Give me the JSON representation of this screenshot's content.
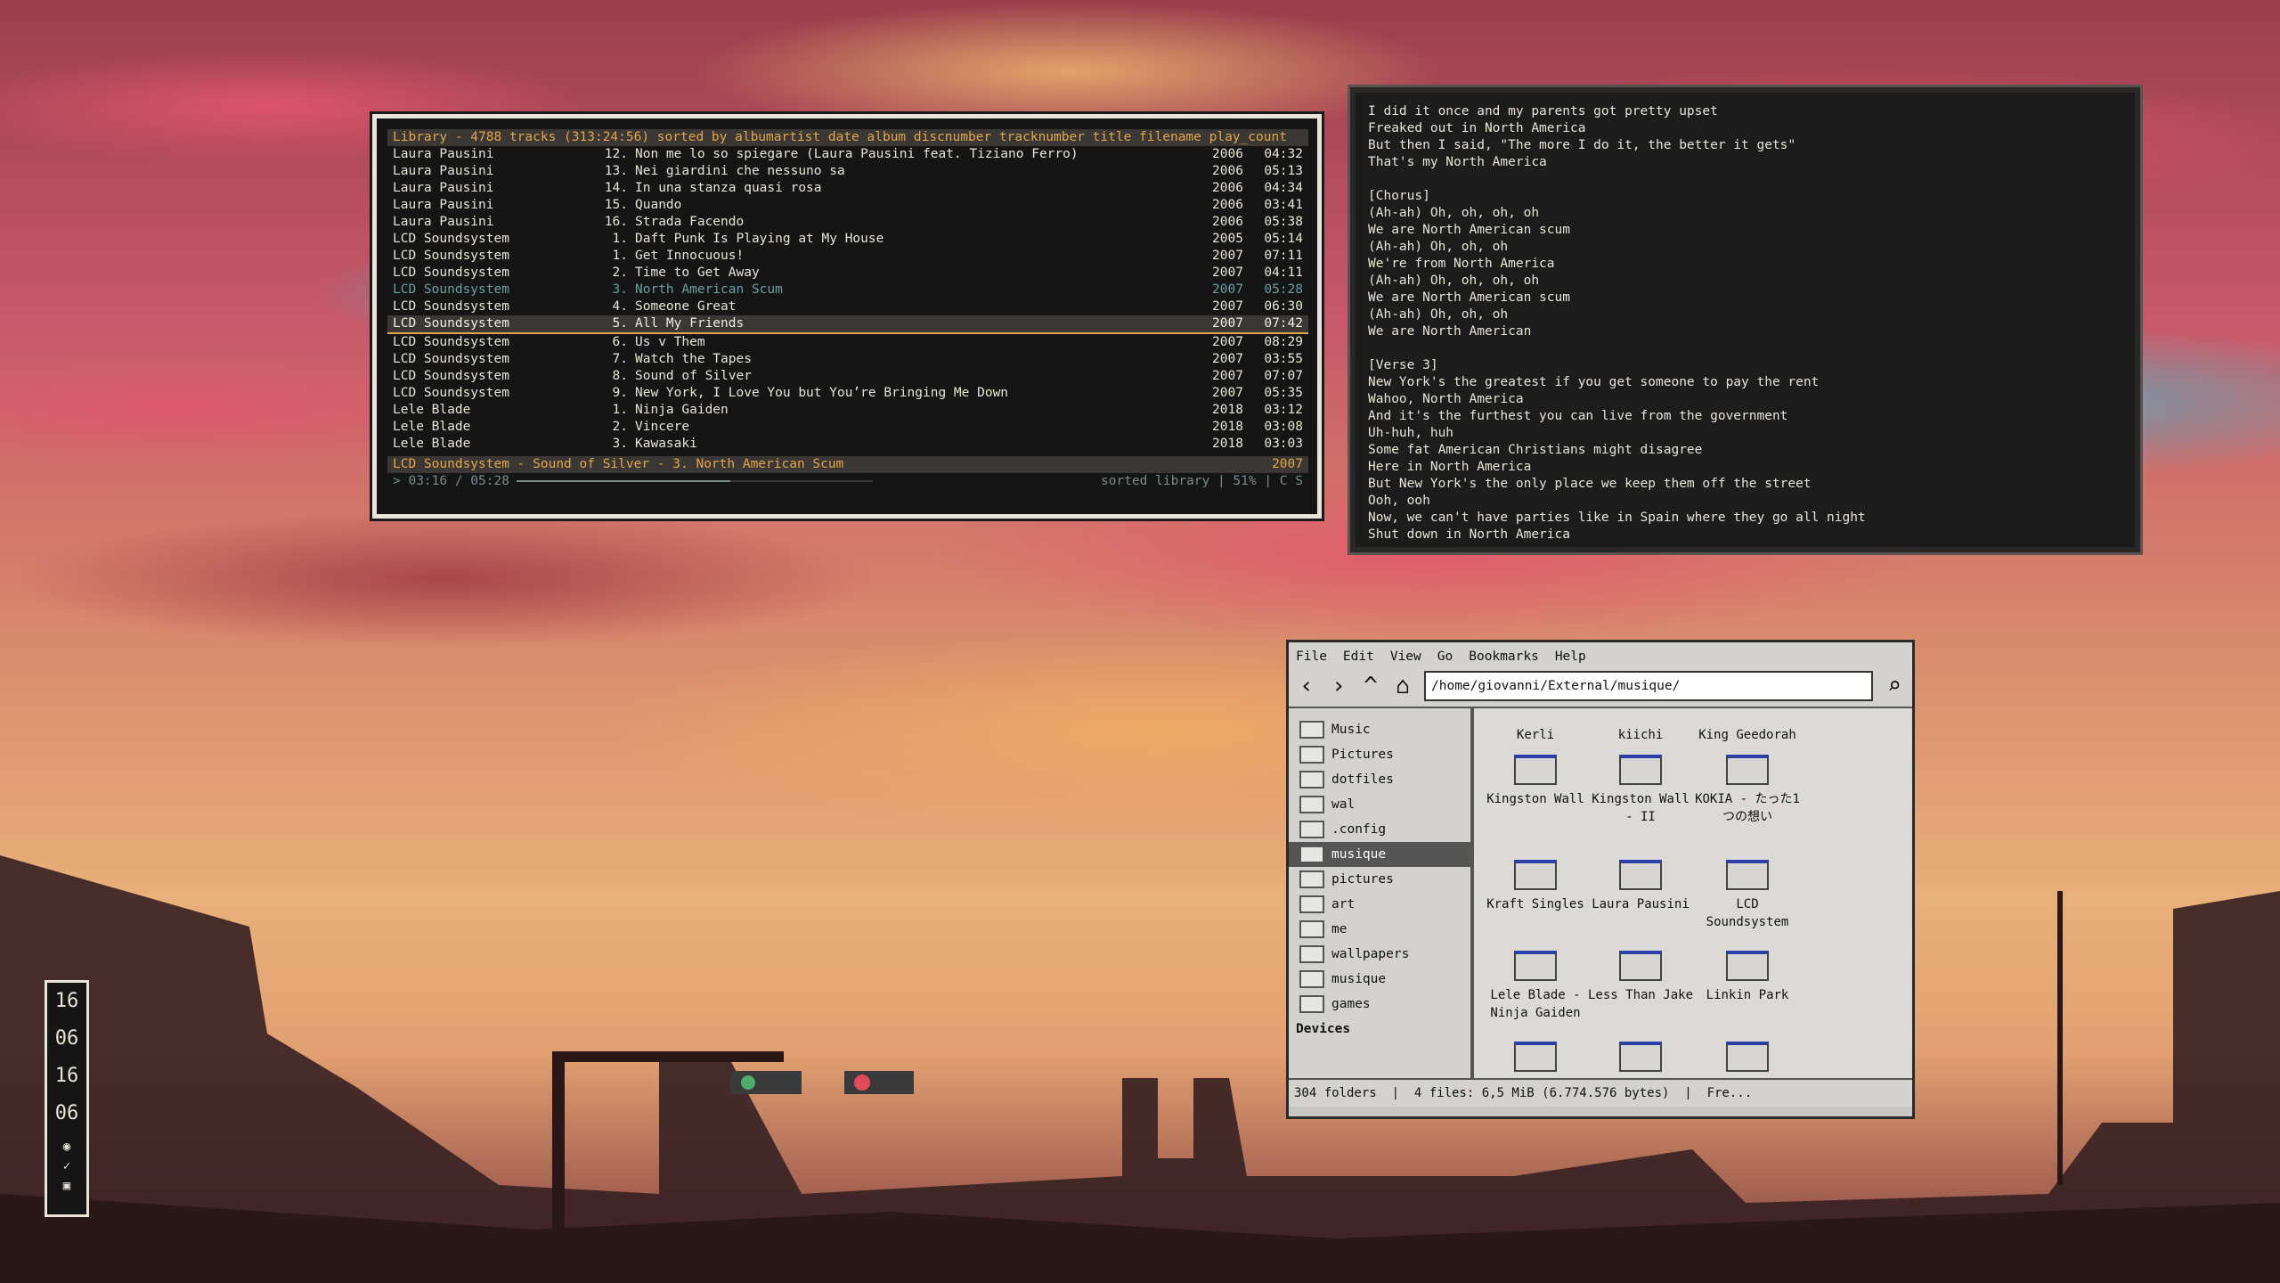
{
  "music_player": {
    "title_line": "Library - 4788 tracks (313:24:56) sorted by albumartist date album discnumber tracknumber title filename play_count",
    "tracks": [
      {
        "artist": "Laura Pausini",
        "num": "12.",
        "title": "Non me lo so spiegare (Laura Pausini feat. Tiziano Ferro)",
        "year": "2006",
        "dur": "04:32"
      },
      {
        "artist": "Laura Pausini",
        "num": "13.",
        "title": "Nei giardini che nessuno sa",
        "year": "2006",
        "dur": "05:13"
      },
      {
        "artist": "Laura Pausini",
        "num": "14.",
        "title": "In una stanza quasi rosa",
        "year": "2006",
        "dur": "04:34"
      },
      {
        "artist": "Laura Pausini",
        "num": "15.",
        "title": "Quando",
        "year": "2006",
        "dur": "03:41"
      },
      {
        "artist": "Laura Pausini",
        "num": "16.",
        "title": "Strada Facendo",
        "year": "2006",
        "dur": "05:38"
      },
      {
        "artist": "LCD Soundsystem",
        "num": "1.",
        "title": "Daft Punk Is Playing at My House",
        "year": "2005",
        "dur": "05:14"
      },
      {
        "artist": "LCD Soundsystem",
        "num": "1.",
        "title": "Get Innocuous!",
        "year": "2007",
        "dur": "07:11"
      },
      {
        "artist": "LCD Soundsystem",
        "num": "2.",
        "title": "Time to Get Away",
        "year": "2007",
        "dur": "04:11"
      },
      {
        "artist": "LCD Soundsystem",
        "num": "3.",
        "title": "North American Scum",
        "year": "2007",
        "dur": "05:28"
      },
      {
        "artist": "LCD Soundsystem",
        "num": "4.",
        "title": "Someone Great",
        "year": "2007",
        "dur": "06:30"
      },
      {
        "artist": "LCD Soundsystem",
        "num": "5.",
        "title": "All My Friends",
        "year": "2007",
        "dur": "07:42"
      },
      {
        "artist": "LCD Soundsystem",
        "num": "6.",
        "title": "Us v Them",
        "year": "2007",
        "dur": "08:29"
      },
      {
        "artist": "LCD Soundsystem",
        "num": "7.",
        "title": "Watch the Tapes",
        "year": "2007",
        "dur": "03:55"
      },
      {
        "artist": "LCD Soundsystem",
        "num": "8.",
        "title": "Sound of Silver",
        "year": "2007",
        "dur": "07:07"
      },
      {
        "artist": "LCD Soundsystem",
        "num": "9.",
        "title": "New York, I Love You but You’re Bringing Me Down",
        "year": "2007",
        "dur": "05:35"
      },
      {
        "artist": "Lele Blade",
        "num": "1.",
        "title": "Ninja Gaiden",
        "year": "2018",
        "dur": "03:12"
      },
      {
        "artist": "Lele Blade",
        "num": "2.",
        "title": "Vincere",
        "year": "2018",
        "dur": "03:08"
      },
      {
        "artist": "Lele Blade",
        "num": "3.",
        "title": "Kawasaki",
        "year": "2018",
        "dur": "03:03"
      }
    ],
    "now_playing": "LCD Soundsystem - Sound of Silver - 3. North American Scum",
    "now_playing_year": "2007",
    "position": "> 03:16 / 05:28",
    "progress_fraction": 0.6,
    "status_right": "sorted library | 51% | C  S"
  },
  "lyrics": [
    "I did it once and my parents got pretty upset",
    "Freaked out in North America",
    "But then I said, \"The more I do it, the better it gets\"",
    "That's my North America",
    "",
    "[Chorus]",
    "(Ah-ah) Oh, oh, oh, oh",
    "We are North American scum",
    "(Ah-ah) Oh, oh, oh",
    "We're from North America",
    "(Ah-ah) Oh, oh, oh, oh",
    "We are North American scum",
    "(Ah-ah) Oh, oh, oh",
    "We are North American",
    "",
    "[Verse 3]",
    "New York's the greatest if you get someone to pay the rent",
    "Wahoo, North America",
    "And it's the furthest you can live from the government",
    "Uh-huh, huh",
    "Some fat American Christians might disagree",
    "Here in North America",
    "But New York's the only place we keep them off the street",
    "Ooh, ooh",
    "Now, we can't have parties like in Spain where they go all night",
    "Shut down in North America"
  ],
  "file_manager": {
    "menu": [
      "File",
      "Edit",
      "View",
      "Go",
      "Bookmarks",
      "Help"
    ],
    "path": "/home/giovanni/External/musique/",
    "sidebar": [
      "Music",
      "Pictures",
      "dotfiles",
      "wal",
      ".config",
      "musique",
      "pictures",
      "art",
      "me",
      "wallpapers",
      "musique",
      "games"
    ],
    "sidebar_selected": 5,
    "devices_label": "Devices",
    "folders": [
      "Kerli",
      "kiichi",
      "King Geedorah",
      "Kingston Wall",
      "Kingston Wall - II",
      "KOKIA - たった1つの想い",
      "Kraft Singles",
      "Laura Pausini",
      "LCD Soundsystem",
      "Lele Blade - Ninja Gaiden",
      "Less Than Jake",
      "Linkin Park",
      "",
      "",
      ""
    ],
    "status": "304 folders  |  4 files: 6,5 MiB (6.774.576 bytes)  |  Fre..."
  },
  "clock": {
    "h1": "16",
    "m1": "06",
    "h2": "16",
    "m2": "06"
  },
  "colors": {
    "accent": "#e3a64a",
    "playing": "#6a9ea2",
    "terminal_bg": "#151515"
  }
}
